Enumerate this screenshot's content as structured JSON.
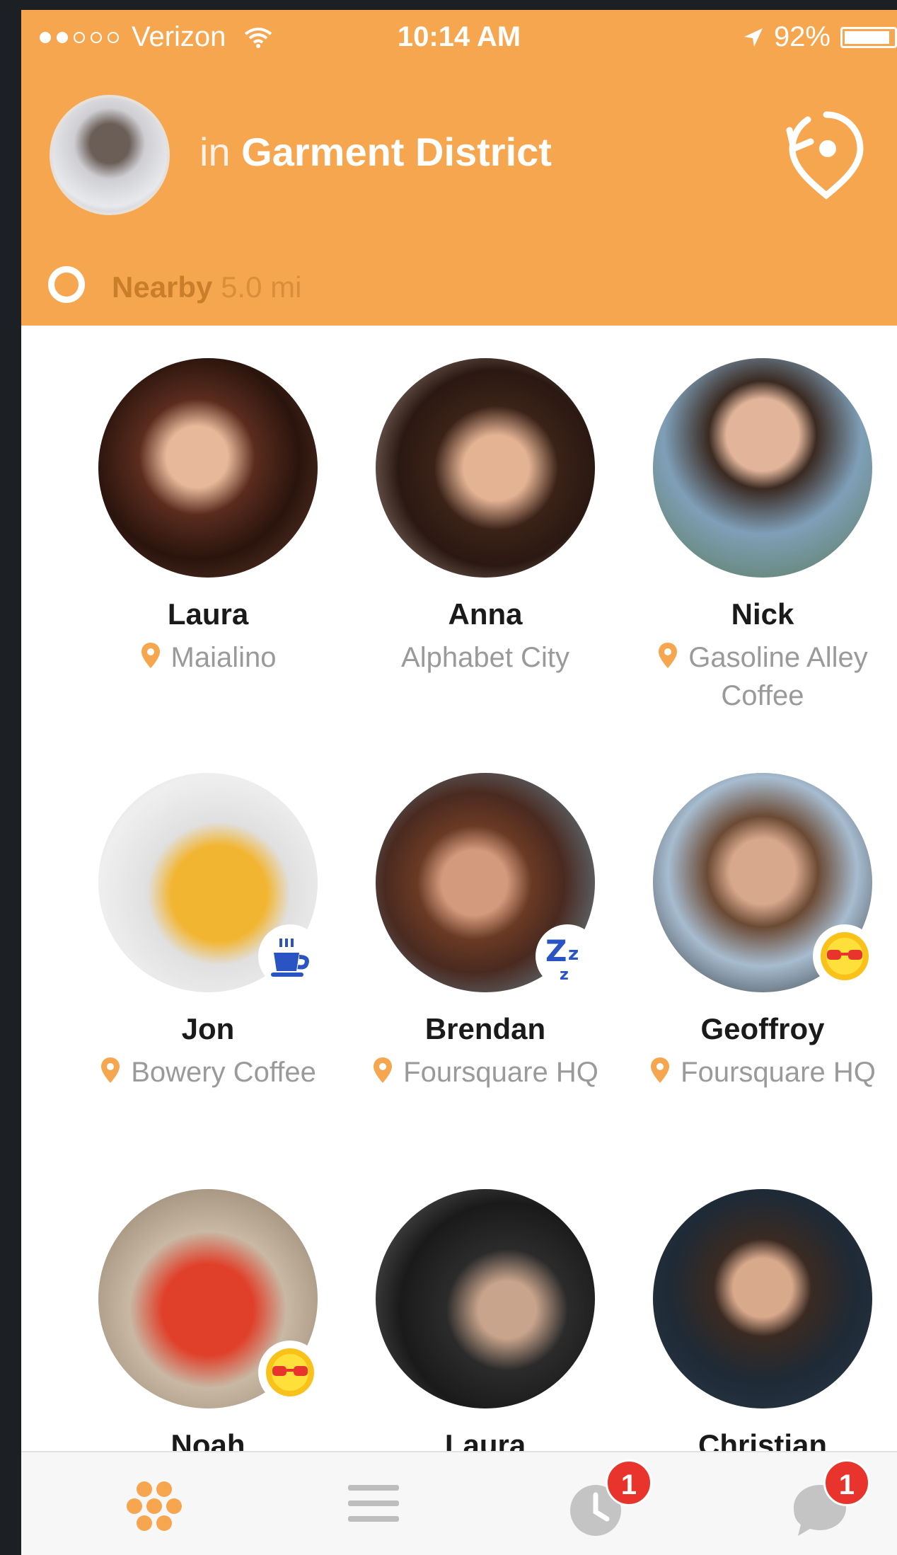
{
  "colors": {
    "accent": "#f7a650",
    "accent_dark": "#c97f2a",
    "badge_red": "#e8342c"
  },
  "status_bar": {
    "carrier": "Verizon",
    "time": "10:14 AM",
    "battery": "92%"
  },
  "header": {
    "location_prefix": "in",
    "location_name": "Garment District",
    "checkin_icon": "checkin-pin-icon"
  },
  "filter": {
    "label": "Nearby",
    "distance": "5.0 mi"
  },
  "people": [
    {
      "name": "Laura",
      "location": "Maialino",
      "has_pin": true,
      "badge": ""
    },
    {
      "name": "Anna",
      "location": "Alphabet City",
      "has_pin": false,
      "badge": ""
    },
    {
      "name": "Nick",
      "location": "Gasoline Alley Coffee",
      "has_pin": true,
      "badge": ""
    },
    {
      "name": "Jon",
      "location": "Bowery Coffee",
      "has_pin": true,
      "badge": "coffee-icon"
    },
    {
      "name": "Brendan",
      "location": "Foursquare HQ",
      "has_pin": true,
      "badge": "sleeping-zzz-icon"
    },
    {
      "name": "Geoffroy",
      "location": "Foursquare HQ",
      "has_pin": true,
      "badge": "sunglasses-sun-icon"
    },
    {
      "name": "Noah",
      "location": "",
      "has_pin": false,
      "badge": "sunglasses-sun-icon"
    },
    {
      "name": "Laura",
      "location": "",
      "has_pin": false,
      "badge": ""
    },
    {
      "name": "Christian",
      "location": "",
      "has_pin": false,
      "badge": ""
    }
  ],
  "tabbar": {
    "tabs": [
      {
        "icon": "honeycomb-icon",
        "active": true,
        "count": ""
      },
      {
        "icon": "list-icon",
        "active": false,
        "count": ""
      },
      {
        "icon": "clock-icon",
        "active": false,
        "count": "1"
      },
      {
        "icon": "chat-icon",
        "active": false,
        "count": "1"
      }
    ]
  }
}
